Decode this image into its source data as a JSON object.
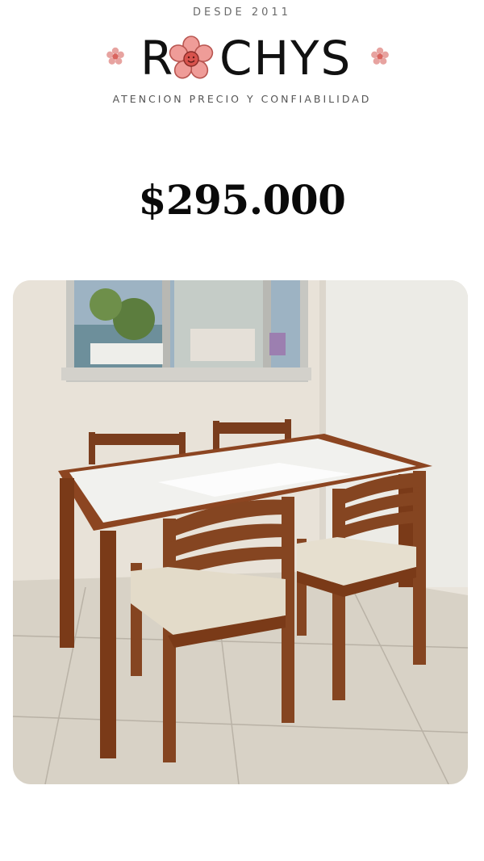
{
  "brand": {
    "since": "DESDE 2011",
    "name_first": "R",
    "name_rest": "CHYS",
    "tagline": "ATENCION PRECIO Y CONFIABILIDAD",
    "accent_color": "#e88a8a",
    "icon": "flower-icon"
  },
  "product": {
    "price": "$295.000",
    "image": "dining-table-with-four-chairs-photo"
  }
}
